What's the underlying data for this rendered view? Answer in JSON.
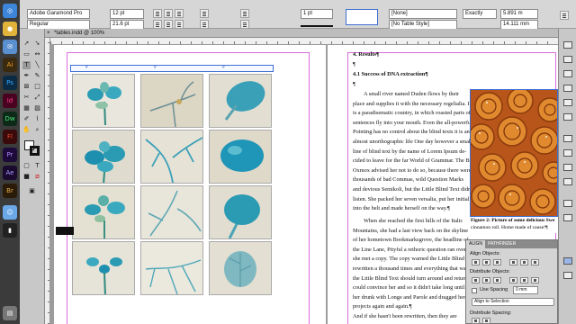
{
  "control_panel": {
    "font_family": "Adobe Garamond Pro",
    "font_style": "Regular",
    "font_size": "12 pt",
    "leading": "21.6 pt",
    "stroke_weight": "1 pt",
    "paragraph_style": "[None]",
    "table_style": "[No Table Style]",
    "fit_mode": "Exactly",
    "row_height": "5.891 m",
    "column_width": "14.111 mm"
  },
  "document_tab": {
    "title": "*tables.indd @ 100%"
  },
  "document": {
    "section_heading": "4.   Results¶",
    "pilcrow": "¶",
    "subsection_heading": "4.1   Success of DNA extraction¶",
    "body_lines": [
      "A small river named Duden flows by their",
      "place and supplies it with the necessary regelialia. It",
      "is a paradisematic country, in which roasted parts of",
      "sentences fly into your mouth. Even the all-powerful",
      "Pointing has no control about the blind texts it is an",
      "almost unorthographic life One day however a small",
      "line of blind text by the name of Lorem Ipsum de-",
      "cided to leave for the far World of Grammar. The Big",
      "Oxmox advised her not to do so, because there were",
      "thousands of bad Commas, wild Question Marks",
      "and devious Semikoli, but the Little Blind Text didn't",
      "listen. She packed her seven versalia, put her initial",
      "into the belt and made herself on the way.¶"
    ],
    "body_lines_2": [
      "When she reached the first hills of the Italic",
      "Mountains, she had a last view back on the skyline",
      "of her hometown Bookmarksgrove, the headline of",
      "the Line Lane, Pityful a rethoric question ran over her",
      "she met a copy. The copy warned the Little Blind Text",
      "rewritten a thousand times and everything that was",
      "the Little Blind Text should turn around and return to",
      "could convince her and so it didn't take long until a",
      "her drunk with Longe and Parole and dragged her",
      "projects again and again.¶",
      "And if she hasn't been rewritten, then they are"
    ],
    "figure_caption_line1": "Figure 2: Picture of some delicious Swe",
    "figure_caption_line2": "cinnamon roll. Home made of cause!¶",
    "table_marker": "#"
  },
  "align_panel": {
    "tabs": [
      "ALIGN",
      "PATHFINDER"
    ],
    "align_objects_label": "Align Objects:",
    "distribute_objects_label": "Distribute Objects:",
    "use_spacing_label": "Use Spacing",
    "spacing_value": "0 mm",
    "align_to_label": "Align to Selection",
    "distribute_spacing_label": "Distribute Spacing:"
  },
  "dock_apps": [
    "Ai",
    "Ps",
    "Id",
    "Dw",
    "Fl",
    "Pr",
    "Ae",
    "Br"
  ],
  "colors": {
    "accent_selection": "#3d6fd6",
    "guide_magenta": "#d96bd9",
    "stain_blue": "#2a9bb3"
  }
}
